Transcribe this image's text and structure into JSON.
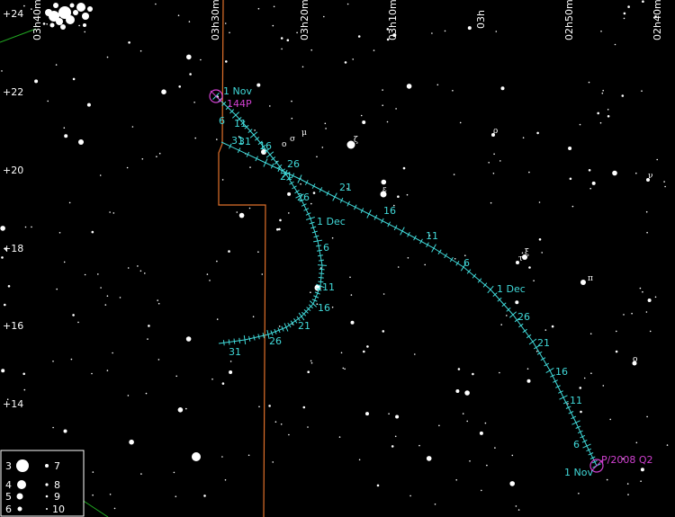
{
  "ra_labels": [
    "03h40m",
    "03h30m",
    "03h20m",
    "03h10m",
    "03h",
    "02h50m",
    "02h40m"
  ],
  "dec_labels": [
    "+24",
    "+22",
    "+20",
    "+18",
    "+16",
    "+14"
  ],
  "colors": {
    "background": "#000000",
    "stars": "#ffffff",
    "path": "#40d8d8",
    "comet_marker": "#d040d0",
    "boundary": "#e0702a",
    "ecliptic": "#22aa22"
  },
  "comets": [
    {
      "name": "144P",
      "start_label": "1 Nov",
      "date_labels": [
        "1 Nov",
        "6",
        "11",
        "16",
        "21",
        "26",
        "31",
        "6",
        "11",
        "16",
        "21",
        "26",
        "1 Dec",
        "6",
        "11",
        "16",
        "21",
        "26",
        "31"
      ]
    },
    {
      "name": "P/2008 Q2",
      "start_label": "1 Nov",
      "date_labels": [
        "1 Nov",
        "6",
        "11",
        "16",
        "21",
        "26",
        "1 Dec",
        "6",
        "11",
        "16",
        "21",
        "26",
        "31"
      ]
    }
  ],
  "star_names": [
    "ζ",
    "ε",
    "π",
    "o",
    "ν",
    "ξ",
    "ρ",
    "μ",
    "σ",
    "ο",
    "τ"
  ],
  "legend": {
    "magnitudes": [
      "3",
      "4",
      "5",
      "6",
      "7",
      "8",
      "9",
      "10"
    ]
  }
}
